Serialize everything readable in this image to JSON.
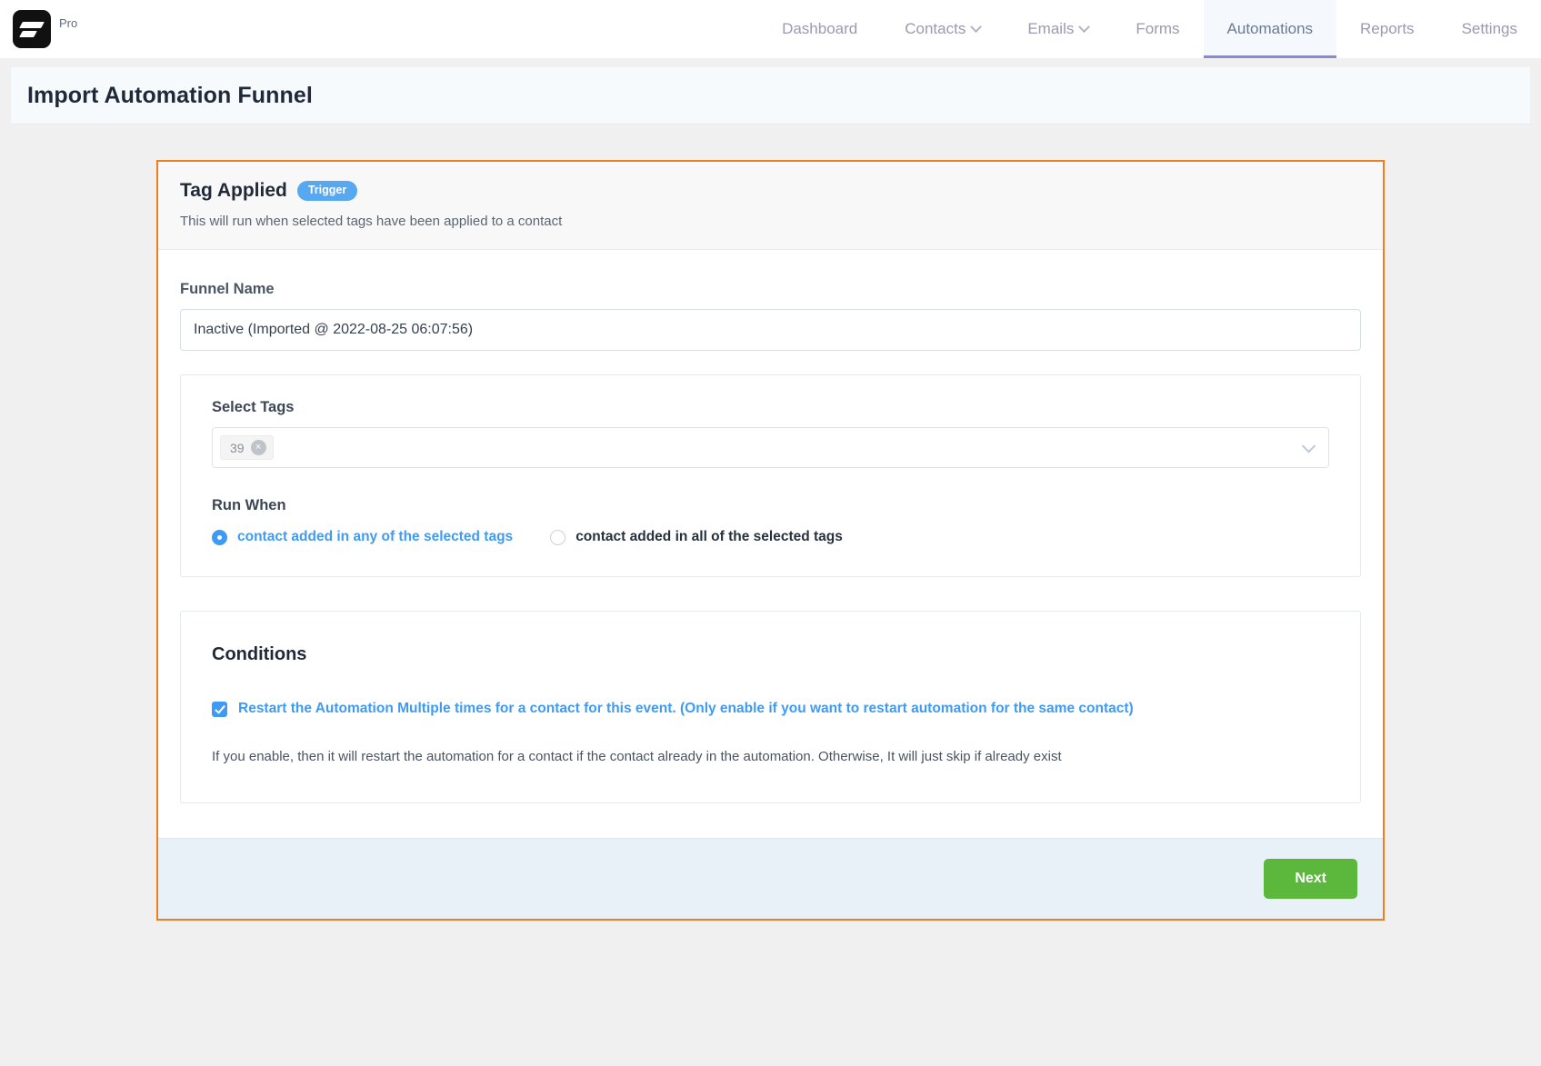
{
  "brand": {
    "sub_label": "Pro",
    "logo_icon": "flow-bolt-logo-icon"
  },
  "nav": {
    "items": [
      {
        "label": "Dashboard",
        "has_caret": false,
        "active": false
      },
      {
        "label": "Contacts",
        "has_caret": true,
        "active": false
      },
      {
        "label": "Emails",
        "has_caret": true,
        "active": false
      },
      {
        "label": "Forms",
        "has_caret": false,
        "active": false
      },
      {
        "label": "Automations",
        "has_caret": false,
        "active": true
      },
      {
        "label": "Reports",
        "has_caret": false,
        "active": false
      },
      {
        "label": "Settings",
        "has_caret": false,
        "active": false
      }
    ]
  },
  "page": {
    "title": "Import Automation Funnel"
  },
  "trigger_card": {
    "title": "Tag Applied",
    "badge": "Trigger",
    "description": "This will run when selected tags have been applied to a contact",
    "funnel_name": {
      "label": "Funnel Name",
      "value": "Inactive (Imported @ 2022-08-25 06:07:56)",
      "placeholder": "Funnel Name"
    },
    "select_tags": {
      "label": "Select Tags",
      "chips": [
        {
          "label": "39",
          "remove_icon": "×"
        }
      ],
      "caret_icon": "chevron-down-icon"
    },
    "run_when": {
      "label": "Run When",
      "options": [
        {
          "label": "contact added in any of the selected tags",
          "selected": true
        },
        {
          "label": "contact added in all of the selected tags",
          "selected": false
        }
      ]
    },
    "conditions": {
      "title": "Conditions",
      "checkbox_label": "Restart the Automation Multiple times for a contact for this event. (Only enable if you want to restart automation for the same contact)",
      "checked": true,
      "help_text": "If you enable, then it will restart the automation for a contact if the contact already in the automation. Otherwise, It will just skip if already exist"
    },
    "footer": {
      "next_label": "Next"
    }
  },
  "colors": {
    "card_border": "#f07d20",
    "accent_blue": "#3e9bf5",
    "badge_blue": "#56a9f0",
    "next_green": "#5cb83c",
    "active_tab_underline": "#8b86d6"
  }
}
